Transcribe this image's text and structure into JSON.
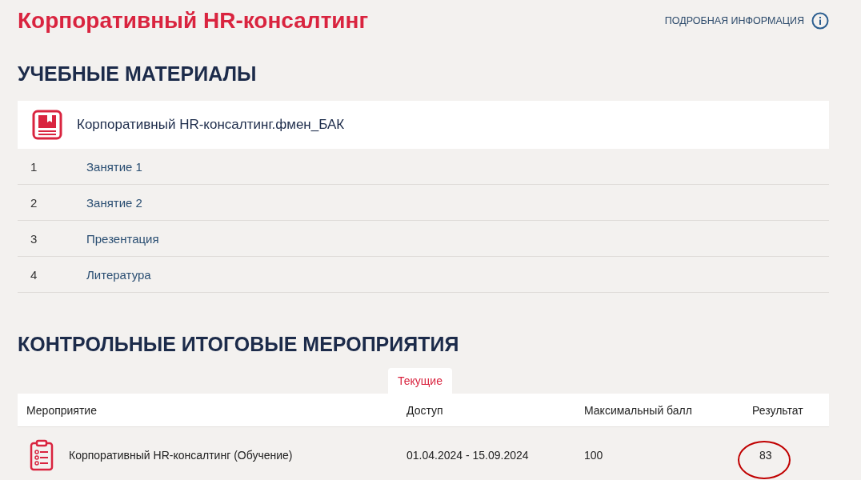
{
  "course_title": "Корпоративный HR-консалтинг",
  "info_link": {
    "label": "ПОДРОБНАЯ ИНФОРМАЦИЯ"
  },
  "materials": {
    "heading": "УЧЕБНЫЕ МАТЕРИАЛЫ",
    "book_title": "Корпоративный HR-консалтинг.фмен_БАК",
    "items": [
      {
        "number": "1",
        "title": "Занятие 1"
      },
      {
        "number": "2",
        "title": "Занятие 2"
      },
      {
        "number": "3",
        "title": "Презентация"
      },
      {
        "number": "4",
        "title": "Литература"
      }
    ]
  },
  "assessments": {
    "heading": "КОНТРОЛЬНЫЕ ИТОГОВЫЕ МЕРОПРИЯТИЯ",
    "tabs": [
      {
        "label": "Текущие",
        "selected": true
      }
    ],
    "columns": [
      "Мероприятие",
      "Доступ",
      "Максимальный балл",
      "Результат"
    ],
    "rows": [
      {
        "event": "Корпоративный HR-консалтинг (Обучение)",
        "access": "01.04.2024 - 15.09.2024",
        "max_score": "100",
        "result": "83",
        "result_circled": true
      }
    ]
  }
}
